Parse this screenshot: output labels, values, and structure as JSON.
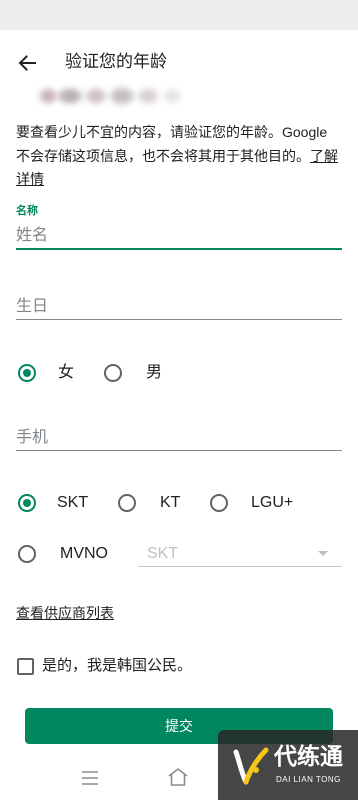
{
  "colors": {
    "accent": "#01875f",
    "text": "#202124",
    "muted": "#5f6368",
    "placeholder": "#80868b",
    "disabled": "#bdc1c6"
  },
  "header": {
    "title": "验证您的年龄",
    "back_icon": "arrow-left-icon"
  },
  "intro": {
    "text": "要查看少儿不宜的内容，请验证您的年龄。Google 不会存储这项信息，也不会将其用于其他目的。",
    "link": "了解详情"
  },
  "form": {
    "name": {
      "label": "名称",
      "placeholder": "姓名",
      "value": ""
    },
    "birthday": {
      "placeholder": "生日",
      "value": ""
    },
    "gender": {
      "options": [
        {
          "label": "女",
          "selected": true
        },
        {
          "label": "男",
          "selected": false
        }
      ]
    },
    "phone": {
      "placeholder": "手机",
      "value": ""
    },
    "carrier": {
      "options": [
        {
          "label": "SKT",
          "selected": true
        },
        {
          "label": "KT",
          "selected": false
        },
        {
          "label": "LGU+",
          "selected": false
        },
        {
          "label": "MVNO",
          "selected": false
        }
      ],
      "mvno_select": {
        "value": "SKT",
        "enabled": false
      }
    },
    "provider_link": "查看供应商列表",
    "citizen_checkbox": {
      "label": "是的，我是韩国公民。",
      "checked": false
    },
    "submit_label": "提交"
  },
  "nav": {
    "icons": [
      "menu-icon",
      "home-icon"
    ]
  },
  "watermark": {
    "name": "代练通",
    "subtitle": "DAI LIAN TONG"
  }
}
